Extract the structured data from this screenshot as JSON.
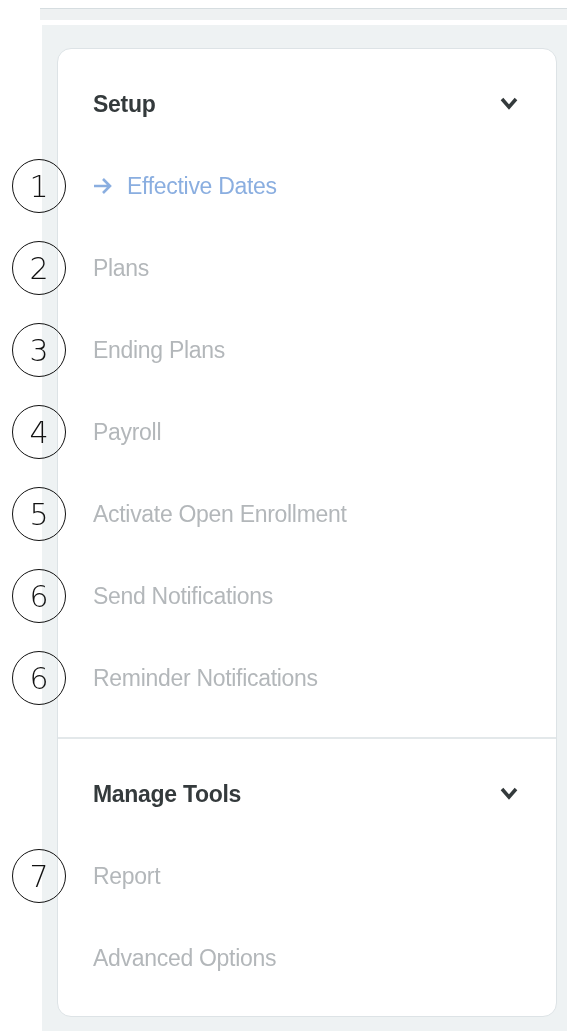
{
  "sections": [
    {
      "title": "Setup",
      "expanded": true,
      "items": [
        {
          "label": "Effective Dates",
          "selected": true,
          "marker": "1"
        },
        {
          "label": "Plans",
          "selected": false,
          "marker": "2"
        },
        {
          "label": "Ending Plans",
          "selected": false,
          "marker": "3"
        },
        {
          "label": "Payroll",
          "selected": false,
          "marker": "4"
        },
        {
          "label": "Activate Open Enrollment",
          "selected": false,
          "marker": "5"
        },
        {
          "label": "Send Notifications",
          "selected": false,
          "marker": "6"
        },
        {
          "label": "Reminder Notifications",
          "selected": false,
          "marker": "6"
        }
      ]
    },
    {
      "title": "Manage Tools",
      "expanded": true,
      "items": [
        {
          "label": "Report",
          "selected": false,
          "marker": "7"
        },
        {
          "label": "Advanced Options",
          "selected": false
        }
      ]
    }
  ]
}
